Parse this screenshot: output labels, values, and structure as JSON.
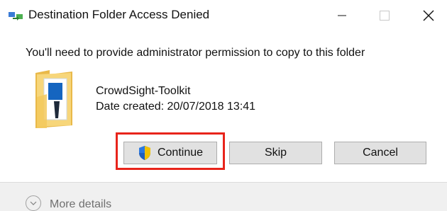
{
  "window": {
    "title": "Destination Folder Access Denied",
    "controls": {
      "minimize": "minimize-icon",
      "maximize": "maximize-icon",
      "close": "close-icon"
    }
  },
  "dialog": {
    "message": "You'll need to provide administrator permission to copy to this folder",
    "item": {
      "icon": "folder-icon",
      "name": "CrowdSight-Toolkit",
      "date_created": "Date created: 20/07/2018 13:41"
    },
    "buttons": {
      "continue": "Continue",
      "skip": "Skip",
      "cancel": "Cancel"
    },
    "more_details": "More details"
  },
  "colors": {
    "highlight": "#e8241b",
    "button_bg": "#e1e1e1",
    "button_border": "#adadad",
    "folder": "#f7d67a"
  }
}
